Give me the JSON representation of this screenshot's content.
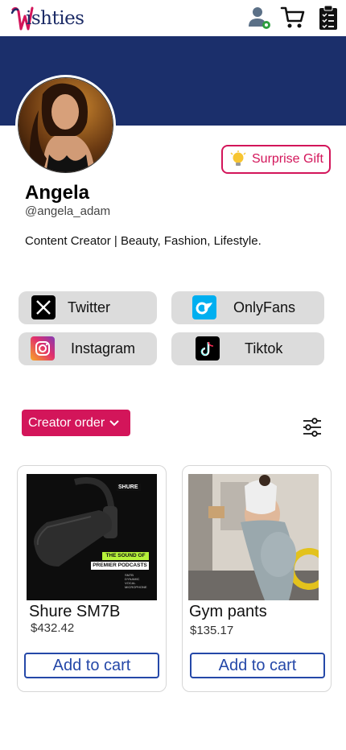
{
  "header": {
    "logo_text": "ishties",
    "logo_alt": "Wishties",
    "icons": [
      "user-settings-icon",
      "cart-icon",
      "checklist-icon"
    ]
  },
  "colors": {
    "brand_navy": "#1b2f6b",
    "accent_pink": "#d3155a",
    "button_blue": "#2548a8"
  },
  "profile": {
    "name": "Angela",
    "handle": "@angela_adam",
    "bio": "Content Creator | Beauty, Fashion, Lifestyle.",
    "surprise_label": "Surprise Gift"
  },
  "socials": [
    {
      "label": "Twitter",
      "icon": "x-twitter-icon"
    },
    {
      "label": "OnlyFans",
      "icon": "onlyfans-icon"
    },
    {
      "label": "Instagram",
      "icon": "instagram-icon"
    },
    {
      "label": "Tiktok",
      "icon": "tiktok-icon"
    }
  ],
  "sort": {
    "label": "Creator order"
  },
  "products": [
    {
      "name": "Shure SM7B",
      "price": "$432.42",
      "cart_label": "Add to cart",
      "image_text": {
        "brand": "SHURE",
        "line1": "THE SOUND OF",
        "line2": "PREMIER PODCASTS",
        "small": "SM7B DYNAMIC VOCAL MICROPHONE"
      }
    },
    {
      "name": "Gym pants",
      "price": "$135.17",
      "cart_label": "Add to cart"
    }
  ]
}
